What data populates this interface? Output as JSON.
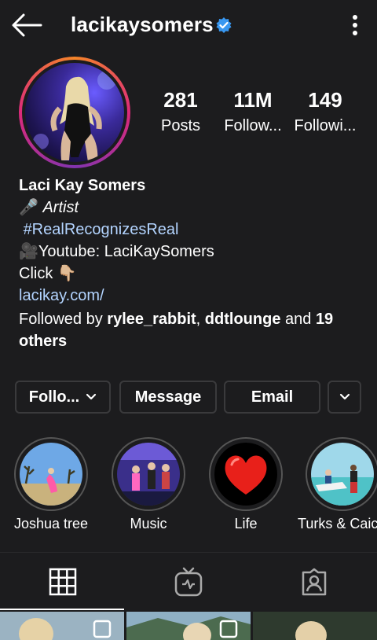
{
  "header": {
    "username": "lacikaysomers"
  },
  "stats": [
    {
      "value": "281",
      "label": "Posts"
    },
    {
      "value": "11M",
      "label": "Follow..."
    },
    {
      "value": "149",
      "label": "Followi..."
    }
  ],
  "bio": {
    "name": "Laci Kay Somers",
    "line1_icon": "🎤",
    "line1": "Artist",
    "hashtag": "#RealRecognizesReal",
    "line3_icon": "🎥",
    "line3": "Youtube: LaciKaySomers",
    "line4": "Click 👇🏼",
    "link": "lacikay.com/",
    "followed_prefix": "Followed by",
    "followed_user1": "rylee_rabbit",
    "followed_sep": ",",
    "followed_user2": "ddtlounge",
    "followed_and": "and",
    "followed_others": "19 others"
  },
  "actions": {
    "follow": "Follo...",
    "message": "Message",
    "email": "Email"
  },
  "highlights": [
    {
      "label": "Joshua tree"
    },
    {
      "label": "Music"
    },
    {
      "label": "Life"
    },
    {
      "label": "Turks & Caicos"
    }
  ],
  "colors": {
    "accent": "#3897f0",
    "link": "#b3d4ff",
    "background": "#1c1c1e"
  }
}
